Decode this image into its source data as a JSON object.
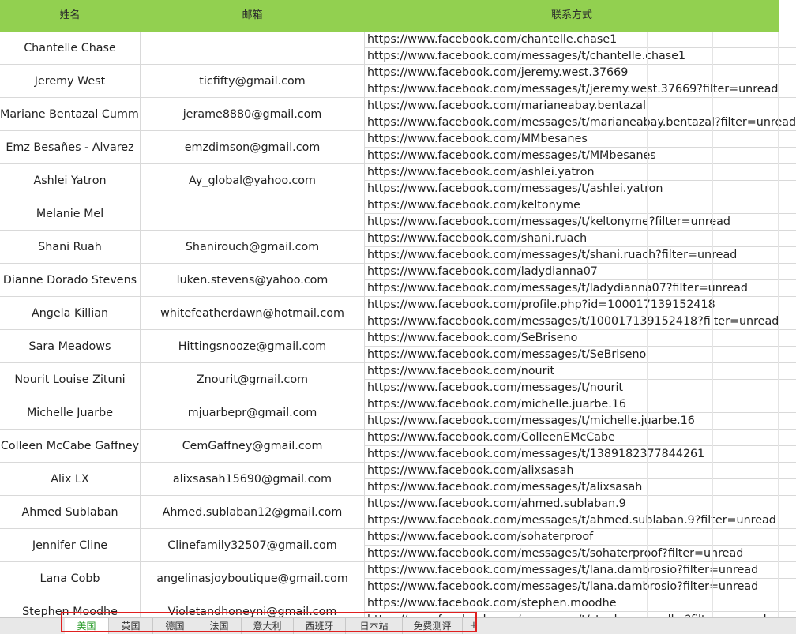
{
  "header": {
    "name": "姓名",
    "email": "邮箱",
    "contact": "联系方式"
  },
  "rows": [
    {
      "name": "Chantelle Chase",
      "email": "",
      "link1": "https://www.facebook.com/chantelle.chase1",
      "link2": "https://www.facebook.com/messages/t/chantelle.chase1"
    },
    {
      "name": "Jeremy West",
      "email": "ticfifty@gmail.com",
      "link1": "https://www.facebook.com/jeremy.west.37669",
      "link2": "https://www.facebook.com/messages/t/jeremy.west.37669?filter=unread"
    },
    {
      "name": "Mariane Bentazal Cumming",
      "email": "jerame8880@gmail.com",
      "link1": "https://www.facebook.com/marianeabay.bentazal",
      "link2": "https://www.facebook.com/messages/t/marianeabay.bentazal?filter=unread"
    },
    {
      "name": "Emz Besañes - Alvarez",
      "email": "emzdimson@gmail.com",
      "link1": "https://www.facebook.com/MMbesanes",
      "link2": "https://www.facebook.com/messages/t/MMbesanes"
    },
    {
      "name": "Ashlei Yatron",
      "email": "Ay_global@yahoo.com",
      "link1": "https://www.facebook.com/ashlei.yatron",
      "link2": "https://www.facebook.com/messages/t/ashlei.yatron"
    },
    {
      "name": "Melanie Mel",
      "email": "",
      "link1": "https://www.facebook.com/keltonyme",
      "link2": "https://www.facebook.com/messages/t/keltonyme?filter=unread"
    },
    {
      "name": "Shani Ruah",
      "email": "Shanirouch@gmail.com",
      "link1": "https://www.facebook.com/shani.ruach",
      "link2": "https://www.facebook.com/messages/t/shani.ruach?filter=unread"
    },
    {
      "name": "Dianne Dorado Stevens",
      "email": "luken.stevens@yahoo.com",
      "link1": "https://www.facebook.com/ladydianna07",
      "link2": "https://www.facebook.com/messages/t/ladydianna07?filter=unread"
    },
    {
      "name": "Angela Killian",
      "email": "whitefeatherdawn@hotmail.com",
      "link1": "https://www.facebook.com/profile.php?id=100017139152418",
      "link2": "https://www.facebook.com/messages/t/100017139152418?filter=unread"
    },
    {
      "name": "Sara Meadows",
      "email": "Hittingsnooze@gmail.com",
      "link1": "https://www.facebook.com/SeBriseno",
      "link2": "https://www.facebook.com/messages/t/SeBriseno"
    },
    {
      "name": "Nourit Louise Zituni",
      "email": "Znourit@gmail.com",
      "link1": "https://www.facebook.com/nourit",
      "link2": "https://www.facebook.com/messages/t/nourit"
    },
    {
      "name": "Michelle Juarbe",
      "email": "mjuarbepr@gmail.com",
      "link1": "https://www.facebook.com/michelle.juarbe.16",
      "link2": "https://www.facebook.com/messages/t/michelle.juarbe.16"
    },
    {
      "name": "Colleen McCabe Gaffney",
      "email": "CemGaffney@gmail.com",
      "link1": "https://www.facebook.com/ColleenEMcCabe",
      "link2": "https://www.facebook.com/messages/t/1389182377844261"
    },
    {
      "name": "Alix LX",
      "email": "alixsasah15690@gmail.com",
      "link1": "https://www.facebook.com/alixsasah",
      "link2": "https://www.facebook.com/messages/t/alixsasah"
    },
    {
      "name": "Ahmed Sublaban",
      "email": "Ahmed.sublaban12@gmail.com",
      "link1": "https://www.facebook.com/ahmed.sublaban.9",
      "link2": "https://www.facebook.com/messages/t/ahmed.sublaban.9?filter=unread"
    },
    {
      "name": "Jennifer Cline",
      "email": "Clinefamily32507@gmail.com",
      "link1": "https://www.facebook.com/sohaterproof",
      "link2": "https://www.facebook.com/messages/t/sohaterproof?filter=unread"
    },
    {
      "name": "Lana Cobb",
      "email": "angelinasjoyboutique@gmail.com",
      "link1": "https://www.facebook.com/messages/t/lana.dambrosio?filter=unread",
      "link2": "https://www.facebook.com/messages/t/lana.dambrosio?filter=unread"
    },
    {
      "name": "Stephen Moodhe",
      "email": "Violetandhoneyni@gmail.com",
      "link1": "https://www.facebook.com/stephen.moodhe",
      "link2": "https://www.facebook.com/messages/t/stephen.moodhe?filter=unread"
    }
  ],
  "sheet_tabs": [
    {
      "label": "美国",
      "active": true
    },
    {
      "label": "英国",
      "active": false
    },
    {
      "label": "德国",
      "active": false
    },
    {
      "label": "法国",
      "active": false
    },
    {
      "label": "意大利",
      "active": false
    },
    {
      "label": "西班牙",
      "active": false
    },
    {
      "label": "日本站",
      "active": false
    },
    {
      "label": "免费测评",
      "active": false
    }
  ],
  "add_sheet_label": "+",
  "colors": {
    "header_bg": "#92d050",
    "active_tab_text": "#2e9e2e",
    "highlight_border": "#e02020"
  }
}
